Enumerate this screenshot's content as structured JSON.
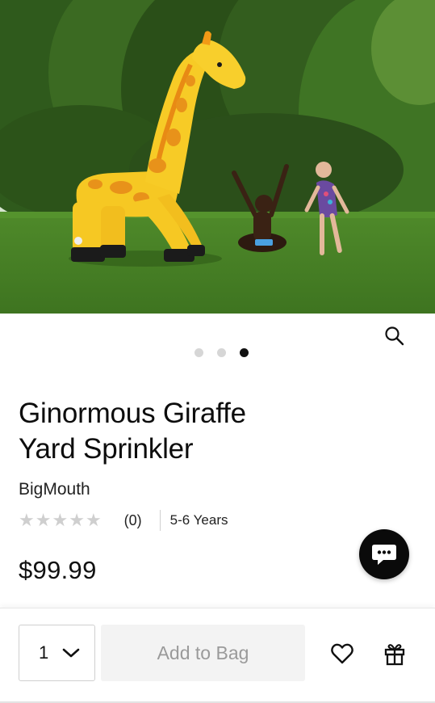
{
  "product": {
    "title_line1": "Ginormous Giraffe",
    "title_line2": "Yard Sprinkler",
    "brand": "BigMouth",
    "rating_count": "(0)",
    "age_range": "5-6 Years",
    "price": "$99.99",
    "stars_filled": 0,
    "stars_total": 5
  },
  "gallery": {
    "image_alt": "Inflatable giraffe sprinkler with children playing on a lawn",
    "dots": 3,
    "active_dot": 3
  },
  "purchase": {
    "quantity": "1",
    "add_to_bag_label": "Add to Bag"
  },
  "icons": {
    "zoom": "search-icon",
    "chat": "chat-bubble-icon",
    "quantity_dropdown": "chevron-down-icon",
    "wishlist": "heart-icon",
    "gift": "gift-icon"
  },
  "colors": {
    "chat_button": "#0a0a0a",
    "add_button_bg": "#f3f3f3",
    "add_button_text": "#9a9a9a",
    "star_empty": "#cfcfcf",
    "active_dot": "#111111",
    "inactive_dot": "#d6d6d6"
  }
}
